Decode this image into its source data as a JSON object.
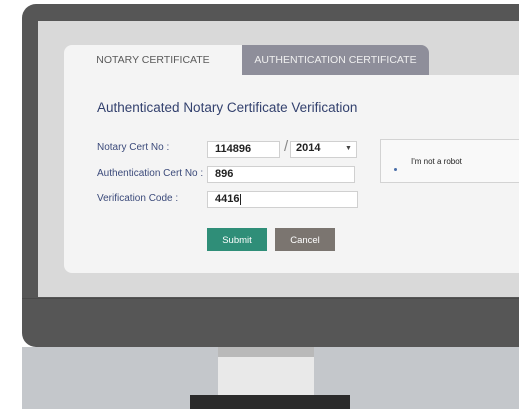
{
  "tabs": [
    {
      "label": "NOTARY CERTIFICATE",
      "active": true
    },
    {
      "label": "AUTHENTICATION CERTIFICATE",
      "active": false
    }
  ],
  "form": {
    "title": "Authenticated Notary Certificate Verification",
    "notary_cert_label": "Notary Cert  No :",
    "notary_cert_value": "114896",
    "separator": "/",
    "year_value": "2014",
    "auth_cert_label": "Authentication Cert No :",
    "auth_cert_value": "896",
    "verification_label": "Verification Code :",
    "verification_value": "4416",
    "submit_label": "Submit",
    "cancel_label": "Cancel"
  },
  "captcha": {
    "label": "I'm not a robot"
  },
  "colors": {
    "heading": "#33416e",
    "submit": "#2f8e78",
    "cancel": "#7b7570",
    "inactive_tab": "#8e8e9a",
    "bezel": "#565656"
  }
}
